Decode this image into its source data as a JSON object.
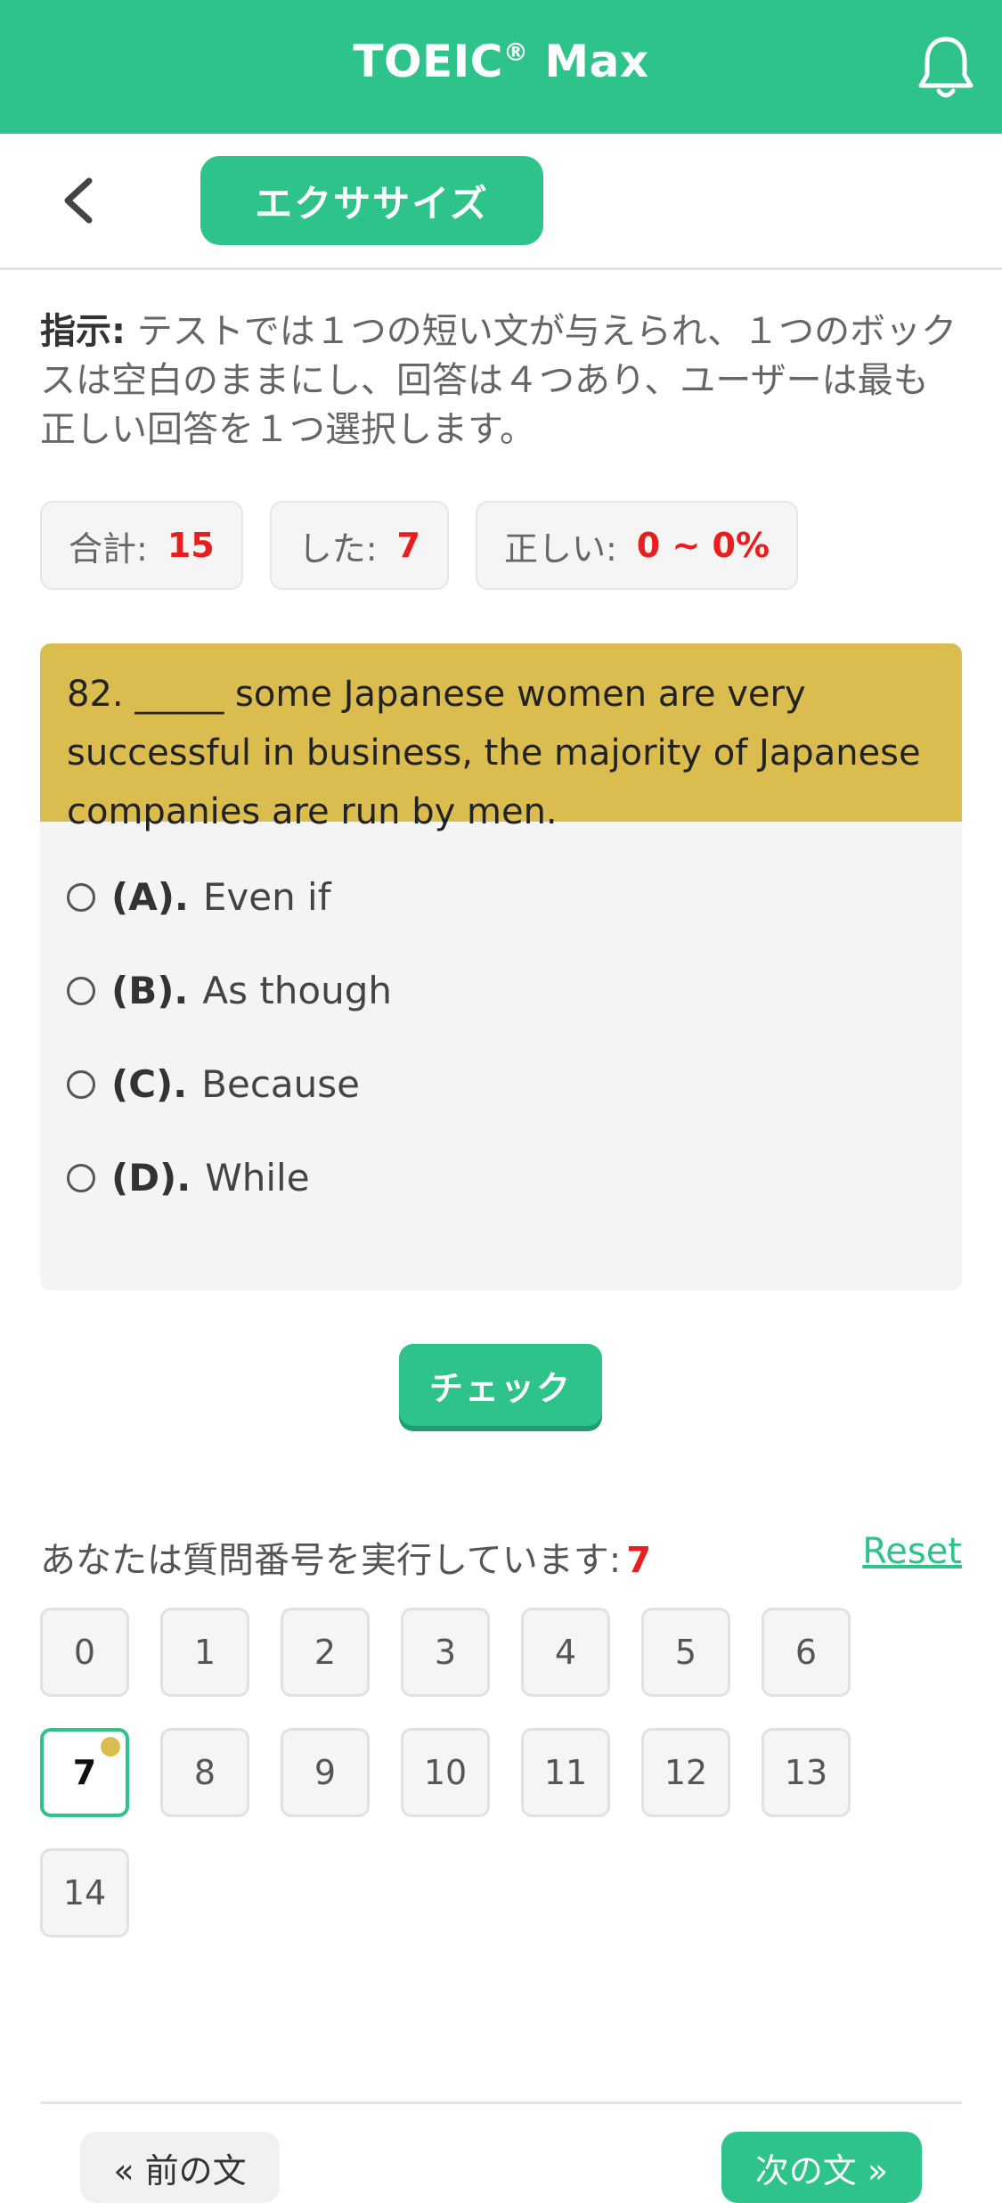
{
  "header": {
    "title": "TOEIC",
    "title_reg": "®",
    "title_suffix": "Max"
  },
  "subheader": {
    "exercise_label": "エクササイズ"
  },
  "instructions": {
    "label": "指示:",
    "text": "テストでは１つの短い文が与えられ、１つのボックスは空白のままにし、回答は４つあり、ユーザーは最も正しい回答を１つ選択します。"
  },
  "stats": [
    {
      "label": "合計:",
      "value": "15"
    },
    {
      "label": "した:",
      "value": "7"
    },
    {
      "label": "正しい:",
      "value": "0 ~ 0%"
    }
  ],
  "question": {
    "text": "82. _____ some Japanese women are very successful in business, the majority of Japanese companies are run by men.",
    "options": [
      {
        "key": "(A).",
        "text": "Even if"
      },
      {
        "key": "(B).",
        "text": "As though"
      },
      {
        "key": "(C).",
        "text": "Because"
      },
      {
        "key": "(D).",
        "text": "While"
      }
    ]
  },
  "check_label": "チェック",
  "progress": {
    "label": "あなたは質問番号を実行しています:",
    "current": "7",
    "reset_label": "Reset"
  },
  "question_numbers": [
    "0",
    "1",
    "2",
    "3",
    "4",
    "5",
    "6",
    "7",
    "8",
    "9",
    "10",
    "11",
    "12",
    "13",
    "14"
  ],
  "active_question": "7",
  "nav": {
    "prev_label": "« 前の文",
    "next_label": "次の文 »"
  },
  "colors": {
    "accent": "#2dc38a",
    "question_bg": "#dbbd4f",
    "highlight": "#e81e1e"
  },
  "icons": {
    "notification": "bell-icon",
    "back": "chevron-left-icon"
  }
}
